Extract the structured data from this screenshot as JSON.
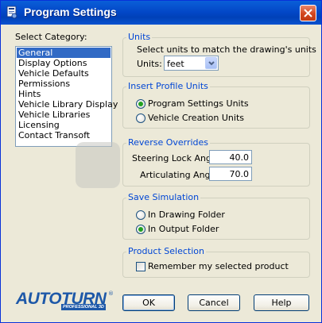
{
  "window": {
    "title": "Program Settings"
  },
  "category": {
    "heading": "Select Category:",
    "items": [
      "General",
      "Display Options",
      "Vehicle Defaults",
      "Permissions",
      "Hints",
      "Vehicle Library Display",
      "Vehicle Libraries",
      "Licensing",
      "Contact Transoft"
    ],
    "selected": "General"
  },
  "units": {
    "title": "Units",
    "description": "Select units to match the drawing's units",
    "label": "Units:",
    "value": "feet"
  },
  "insert_profile": {
    "title": "Insert Profile Units",
    "options": [
      "Program Settings Units",
      "Vehicle Creation Units"
    ],
    "selected": "Program Settings Units"
  },
  "reverse_overrides": {
    "title": "Reverse Overrides",
    "steering_label": "Steering Lock Angle:",
    "steering_value": "40.0",
    "articulating_label": "Articulating Angle:",
    "articulating_value": "70.0"
  },
  "save_simulation": {
    "title": "Save Simulation",
    "options": [
      "In Drawing Folder",
      "In Output Folder"
    ],
    "selected": "In Output Folder"
  },
  "product_selection": {
    "title": "Product Selection",
    "checkbox_label": "Remember my selected product",
    "checked": false
  },
  "buttons": {
    "ok": "OK",
    "cancel": "Cancel",
    "help": "Help"
  },
  "logo": {
    "text": "AUTOTURN",
    "subtitle": "PROFESSIONAL 3D",
    "reg": "®"
  },
  "colors": {
    "titlebar": "#0348c8",
    "dialog_bg": "#ece9d8",
    "selection": "#316ac5",
    "group_title": "#0046d5",
    "logo": "#1d58a8"
  }
}
